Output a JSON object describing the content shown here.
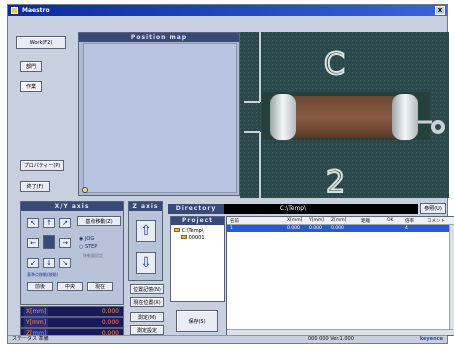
{
  "window": {
    "title": "Maestro",
    "close_glyph": "x"
  },
  "left_menu": {
    "top_button": "Work(F2)",
    "btn_a": "部門",
    "btn_b": "作業",
    "btn_c": "プロパティー(P)",
    "btn_d": "終了(F)"
  },
  "position_map": {
    "header": "Position map"
  },
  "xy_axis": {
    "header": "X/Y axis",
    "right_btn": "基点移動(Z)",
    "radio_jog": "JOG",
    "radio_step": "STEP",
    "radio_extra": "移動量設定",
    "small_label": "基準点移動(移動)",
    "btn_left": "前後",
    "btn_mid": "中央",
    "btn_right": "現在",
    "coords": [
      {
        "label": "X[mm]",
        "value": "0.000"
      },
      {
        "label": "Y[mm]",
        "value": "0.000"
      },
      {
        "label": "Z[mm]",
        "value": "0.000"
      }
    ]
  },
  "z_axis": {
    "header": "Z axis",
    "up_glyph": "⇧",
    "down_glyph": "⇩"
  },
  "mid_buttons": {
    "b1": "位置記憶(N)",
    "b2": "現在位置(X)",
    "b3": "測定(M)",
    "b4": "測定設定"
  },
  "directory": {
    "label": "Directory",
    "path": "C:\\Temp\\",
    "browse_btn": "参照(U)"
  },
  "project": {
    "label": "Project",
    "tree_root": "C:\\Temp\\",
    "tree_child": "00001",
    "save_btn": "保存(S)"
  },
  "table": {
    "columns": [
      "名前",
      "X[mm]",
      "Y[mm]",
      "Z[mm]",
      "距離",
      "OK",
      "倍率",
      "コメント"
    ],
    "selected_row": [
      "1",
      "0.000",
      "0.000",
      "0.000",
      "",
      "",
      "4",
      ""
    ]
  },
  "status": {
    "left": "ステータス 準備",
    "right": "000 000  Ver.1.000",
    "brand": "keyence"
  }
}
